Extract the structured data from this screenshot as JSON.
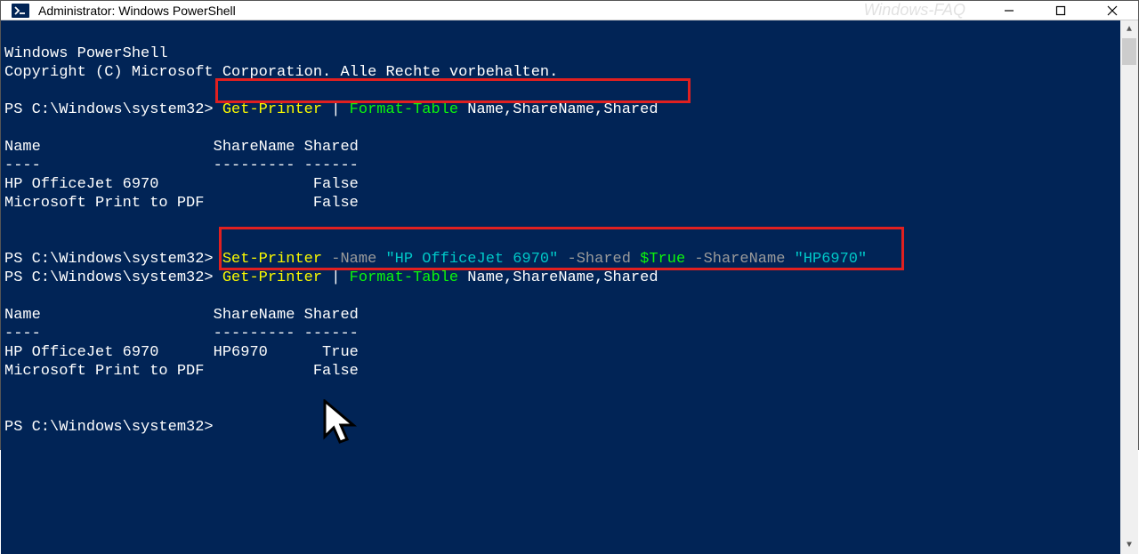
{
  "titlebar": {
    "title": "Administrator: Windows PowerShell",
    "watermark": "Windows-FAQ"
  },
  "terminal": {
    "banner_line1": "Windows PowerShell",
    "banner_line2": "Copyright (C) Microsoft Corporation. Alle Rechte vorbehalten.",
    "prompt": "PS C:\\Windows\\system32> ",
    "commands": {
      "cmd1": {
        "yellow1": "Get-Printer ",
        "white_pipe": "| ",
        "green1": "Format-Table ",
        "white_args": "Name,ShareName,Shared"
      },
      "cmd2": {
        "yellow1": "Set-Printer ",
        "gray_name_flag": "-Name ",
        "teal_name_val": "\"HP OfficeJet 6970\" ",
        "gray_shared_flag": "-Shared ",
        "green_true": "$True ",
        "gray_sharename_flag": "-ShareName ",
        "teal_sharename_val": "\"HP6970\""
      },
      "cmd3": {
        "yellow1": "Get-Printer ",
        "white_pipe": "| ",
        "green1": "Format-Table ",
        "white_args": "Name,ShareName,Shared"
      }
    },
    "table1": {
      "header": "Name                   ShareName Shared",
      "divider": "----                   --------- ------",
      "row1": "HP OfficeJet 6970                 False",
      "row2": "Microsoft Print to PDF            False"
    },
    "table2": {
      "header": "Name                   ShareName Shared",
      "divider": "----                   --------- ------",
      "row1": "HP OfficeJet 6970      HP6970      True",
      "row2": "Microsoft Print to PDF            False"
    }
  }
}
